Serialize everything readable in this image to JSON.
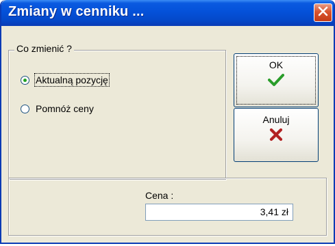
{
  "window": {
    "title": "Zmiany w cenniku ...",
    "close_icon": "close-x-icon"
  },
  "change_group": {
    "legend": "Co zmienić ?",
    "options": [
      {
        "label": "Aktualną pozycję",
        "selected": true
      },
      {
        "label": "Pomnóż ceny",
        "selected": false
      }
    ]
  },
  "buttons": {
    "ok_label": "OK",
    "ok_icon": "checkmark-icon",
    "cancel_label": "Anuluj",
    "cancel_icon": "red-x-icon"
  },
  "price": {
    "label": "Cena :",
    "value": "3,41 zł"
  },
  "colors": {
    "titlebar": "#0451d9",
    "close_button": "#d9542f",
    "check": "#2a9d2a",
    "cross": "#b22222",
    "window_bg": "#ece9d8"
  }
}
